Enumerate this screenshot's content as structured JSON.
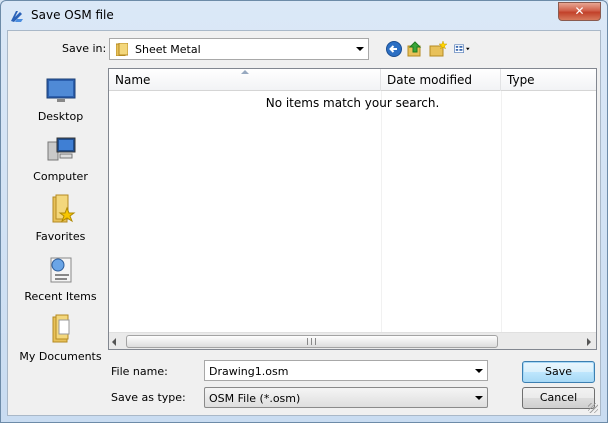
{
  "window": {
    "title": "Save OSM file",
    "close_label": "✕"
  },
  "toolbar": {
    "save_in_label": "Save in:",
    "save_in_value": "Sheet Metal",
    "icons": [
      "back-icon",
      "up-folder-icon",
      "new-folder-icon",
      "views-menu-icon"
    ]
  },
  "places": [
    {
      "label": "Desktop",
      "icon": "desktop-icon"
    },
    {
      "label": "Computer",
      "icon": "computer-icon"
    },
    {
      "label": "Favorites",
      "icon": "favorites-folder-icon"
    },
    {
      "label": "Recent Items",
      "icon": "recent-items-icon"
    },
    {
      "label": "My Documents",
      "icon": "documents-folder-icon"
    }
  ],
  "filelist": {
    "columns": [
      "Name",
      "Date modified",
      "Type"
    ],
    "empty_message": "No items match your search."
  },
  "form": {
    "file_name_label": "File name:",
    "file_name_value": "Drawing1.osm",
    "save_type_label": "Save as type:",
    "save_type_value": "OSM File (*.osm)"
  },
  "buttons": {
    "save": "Save",
    "cancel": "Cancel"
  },
  "colors": {
    "accent": "#3c7fb1",
    "title_bg": "#dbe8f7",
    "close": "#c2412a"
  }
}
